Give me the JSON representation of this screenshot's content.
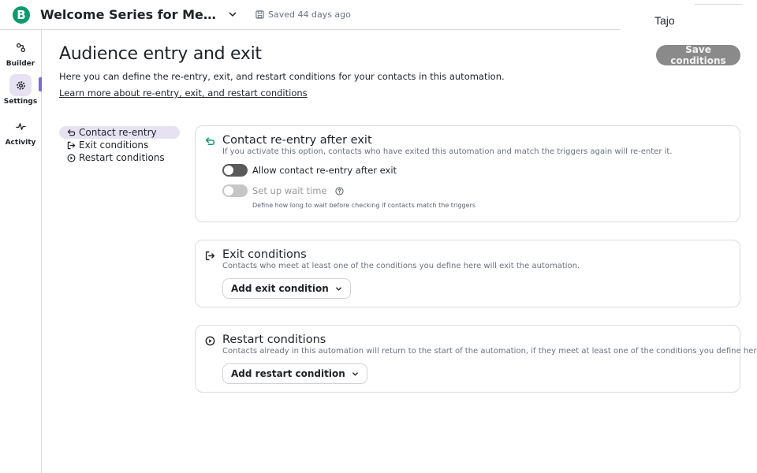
{
  "header": {
    "logo_letter": "B",
    "title": "Welcome Series for Medical Esta...",
    "saved_text": "Saved 44 days ago",
    "user_name": "Tajo"
  },
  "rail": {
    "items": [
      {
        "label": "Builder",
        "icon": "builder-icon"
      },
      {
        "label": "Settings",
        "icon": "gear-icon",
        "active": true
      },
      {
        "label": "Activity",
        "icon": "activity-icon"
      }
    ]
  },
  "page": {
    "title": "Audience entry and exit",
    "description": "Here you can define the re-entry, exit, and restart conditions for your contacts in this automation.",
    "learn_more": "Learn more about re-entry, exit, and restart conditions",
    "save_button": "Save conditions"
  },
  "sidenav": {
    "items": [
      {
        "label": "Contact re-entry",
        "icon": "return-arrow-icon",
        "active": true
      },
      {
        "label": "Exit conditions",
        "icon": "exit-icon"
      },
      {
        "label": "Restart conditions",
        "icon": "play-circle-icon"
      }
    ]
  },
  "reentry": {
    "title": "Contact re-entry after exit",
    "description": "If you activate this option, contacts who have exited this automation and match the triggers again will re-enter it.",
    "toggle_label": "Allow contact re-entry after exit",
    "toggle_on": false,
    "wait_label": "Set up wait time",
    "wait_hint": "Define how long to wait before checking if contacts match the triggers"
  },
  "exit": {
    "title": "Exit conditions",
    "description": "Contacts who meet at least one of the conditions you define here will exit the automation.",
    "button": "Add exit condition"
  },
  "restart": {
    "title": "Restart conditions",
    "description": "Contacts already in this automation will return to the start of the automation, if they meet at least one of the conditions you define here.",
    "button": "Add restart condition"
  },
  "colors": {
    "brand": "#0b996e",
    "accent": "#7c6ad8",
    "active_bg": "#e6e2f3",
    "save_button_bg": "#8a8a8a"
  }
}
